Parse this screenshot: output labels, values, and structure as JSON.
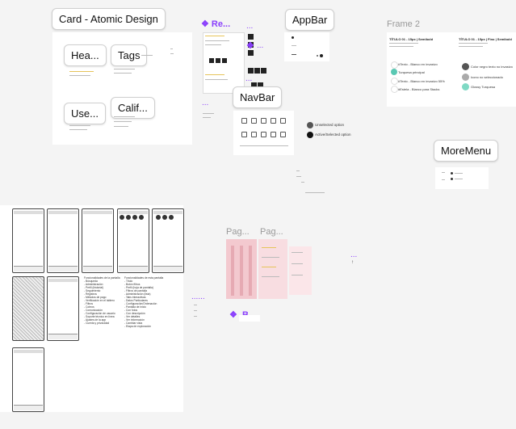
{
  "canvas": {
    "bg_color": "#f4f4f4",
    "accent_purple": "#8a3ffc",
    "teal": "#5ac8b3"
  },
  "card_section": {
    "title": "Card - Atomic Design",
    "chips": {
      "header": "Hea...",
      "tags": "Tags",
      "user": "Use...",
      "rating": "Calif..."
    }
  },
  "components": {
    "re_label": "Re...",
    "appbar": "AppBar",
    "navbar": "NavBar",
    "moremenu": "MoreMenu",
    "frame2": "Frame 2",
    "pag1": "Pag...",
    "pag2": "Pag...",
    "b_label": ".B...",
    "unselected": "Unselected option",
    "selected": "Active/Selected option"
  },
  "frame2": {
    "title_left": "TÍTULO 01 - 15px | Semibold",
    "title_right": "TÍTULO 01 - 15px | Fino | Semibold",
    "legend": [
      {
        "label": "#Texto - Blanco en invasivo",
        "color": "#ffffff"
      },
      {
        "label": "Turquesa principal",
        "color": "#5ac8b3"
      },
      {
        "label": "#Texto - Blanco en invasivo 55%",
        "color": "#ffffff"
      },
      {
        "label": "#Estela - Blanco para Stacks",
        "color": "#ffffff"
      }
    ],
    "legend_right": [
      {
        "label": "Color negro texto no invasivo",
        "color": "#555555"
      },
      {
        "label": "Icono no seleccionado",
        "color": "#aaaaaa"
      },
      {
        "label": "Glossy Turquesa",
        "color": "#7fd9c4"
      }
    ]
  },
  "notes": {
    "block1": "Funcionalidades de la pantalla\n- Búsqueda\n- Administración\n- Perfil (historial)\n- Seguimiento\n- Registros\n- Métodos de pago\n- Verificación en el tablero\n- Filtros\n- Cobros\n- Comunicación\n- Configuración de usuario\n- Soporte técnico en línea\n- Ajustes de la app\n- Cuenta y privacidad",
    "block2": "Funcionalidades de esta pantalla\n- Título\n- Botón filtros\n- Perfil (hoja de pantalla)\n- Filtros de pantalla\n- Administración (lista)\n- Tabs interactivas\n- Datos Particulares\n- Configuración/Ordenación\n- Pantalla de inicio\n- Con fotos\n- Con descripción\n- Ver detalles\n- Ver información\n- Cambiar vista\n- Etapa de exploración"
  }
}
